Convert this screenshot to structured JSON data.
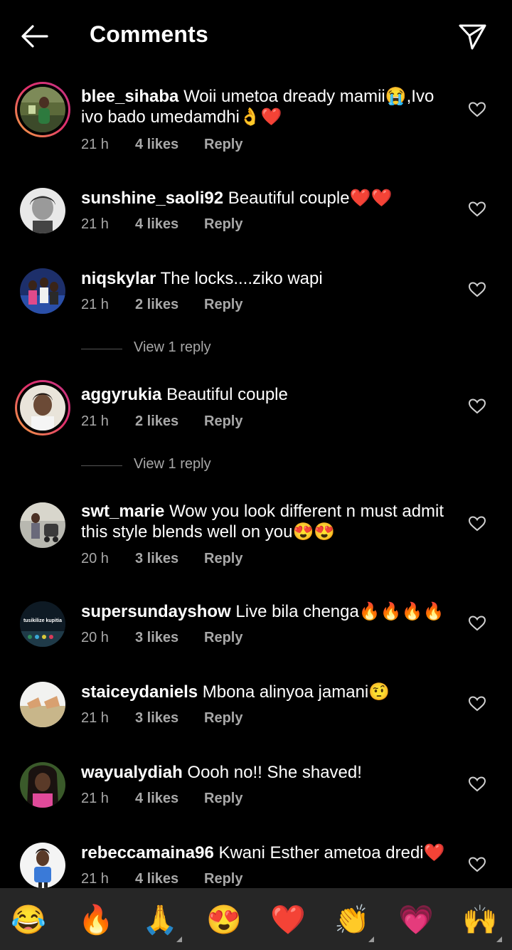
{
  "header": {
    "title": "Comments"
  },
  "comments": [
    {
      "username": "blee_sihaba",
      "text": "Woii umetoa dready mamii😭,Ivo ivo bado umedamdhi👌❤️",
      "time": "21 h",
      "likes": "4 likes",
      "reply": "Reply"
    },
    {
      "username": "sunshine_saoli92",
      "text": "Beautiful couple❤️❤️",
      "time": "21 h",
      "likes": "4 likes",
      "reply": "Reply"
    },
    {
      "username": "niqskylar",
      "text": "The locks....ziko wapi",
      "time": "21 h",
      "likes": "2 likes",
      "reply": "Reply"
    },
    {
      "username": "aggyrukia",
      "text": "Beautiful couple",
      "time": "21 h",
      "likes": "2 likes",
      "reply": "Reply"
    },
    {
      "username": "swt_marie",
      "text": "Wow you look different n must admit this style blends well on you😍😍",
      "time": "20 h",
      "likes": "3 likes",
      "reply": "Reply"
    },
    {
      "username": "supersundayshow",
      "text": "Live bila chenga🔥🔥🔥🔥",
      "time": "20 h",
      "likes": "3 likes",
      "reply": "Reply"
    },
    {
      "username": "staiceydaniels",
      "text": "Mbona alinyoa jamani🤨",
      "time": "21 h",
      "likes": "3 likes",
      "reply": "Reply"
    },
    {
      "username": "wayualydiah",
      "text": "Oooh no!! She shaved!",
      "time": "21 h",
      "likes": "4 likes",
      "reply": "Reply"
    },
    {
      "username": "rebeccamaina96",
      "text": "Kwani Esther ametoa dredi❤️",
      "time": "21 h",
      "likes": "4 likes",
      "reply": "Reply"
    }
  ],
  "view_replies": [
    "View 1 reply",
    "View 1 reply"
  ],
  "avatar_text": {
    "supersundayshow": "tusikilize kupitia"
  },
  "emoji_bar": [
    "😂",
    "🔥",
    "🙏",
    "😍",
    "❤️",
    "👏",
    "💗",
    "🙌"
  ],
  "colors": {
    "background": "#000000",
    "meta_text": "#a8a8a8",
    "emoji_bar": "#262626",
    "story_ring_start": "#f5a742",
    "story_ring_end": "#c13584"
  }
}
